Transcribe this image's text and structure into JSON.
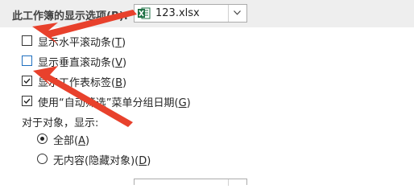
{
  "section": {
    "title": "此工作簿的显示选项(B):"
  },
  "workbook_select": {
    "value": "123.xlsx",
    "icon": "excel-file-icon"
  },
  "options": [
    {
      "text": "显示水平滚动条",
      "key": "T",
      "checked": false
    },
    {
      "text": "显示垂直滚动条",
      "key": "V",
      "checked": false
    },
    {
      "text": "显示工作表标签",
      "key": "B",
      "checked": true
    },
    {
      "text": "使用“自动筛选”菜单分组日期",
      "key": "G",
      "checked": true
    }
  ],
  "objects": {
    "heading": "对于对象，显示:",
    "radios": [
      {
        "text": "全部",
        "key": "A",
        "selected": true
      },
      {
        "text": "无内容(隐藏对象)",
        "key": "D",
        "selected": false
      }
    ]
  },
  "annotation": {
    "color": "#e8412c"
  }
}
